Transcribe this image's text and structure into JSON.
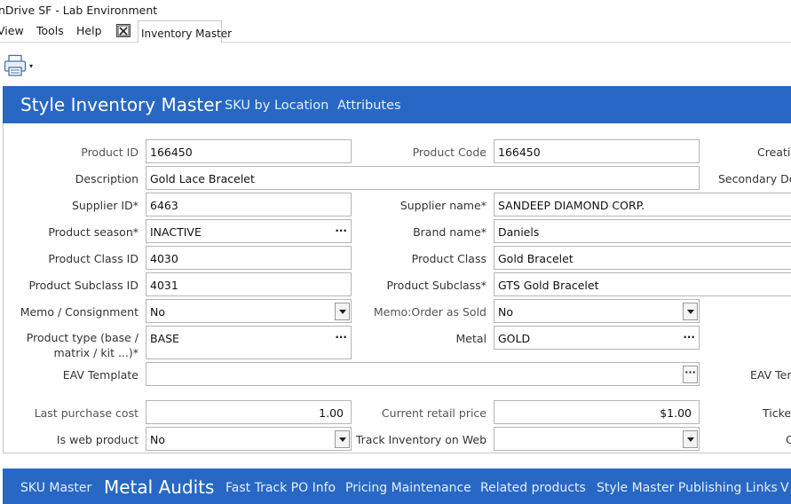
{
  "window": {
    "title": "nDrive SF - Lab Environment"
  },
  "menu": {
    "items": [
      "View",
      "Tools",
      "Help"
    ],
    "doc_tab": "Inventory Master"
  },
  "tabs_top": {
    "active": "Style Inventory Master",
    "others": [
      "SKU by Location",
      "Attributes"
    ]
  },
  "form": {
    "product_id": {
      "label": "Product ID",
      "value": "166450"
    },
    "product_code": {
      "label": "Product Code",
      "value": "166450"
    },
    "creation": {
      "label": "Creatio"
    },
    "description": {
      "label": "Description",
      "value": "Gold Lace Bracelet"
    },
    "secondary_desc": {
      "label": "Secondary De"
    },
    "supplier_id": {
      "label": "Supplier ID*",
      "value": "6463"
    },
    "supplier_name": {
      "label": "Supplier name*",
      "value": "SANDEEP DIAMOND CORP."
    },
    "product_season": {
      "label": "Product season*",
      "value": "INACTIVE"
    },
    "brand_name": {
      "label": "Brand name*",
      "value": "Daniels"
    },
    "product_class_id": {
      "label": "Product Class ID",
      "value": "4030"
    },
    "product_class": {
      "label": "Product Class",
      "value": "Gold Bracelet"
    },
    "product_subclass_id": {
      "label": "Product Subclass ID",
      "value": "4031"
    },
    "product_subclass": {
      "label": "Product Subclass*",
      "value": "GTS Gold Bracelet"
    },
    "memo_consignment": {
      "label": "Memo / Consignment",
      "value": "No"
    },
    "memo_order_as_sold": {
      "label": "Memo:Order as Sold",
      "value": "No"
    },
    "product_type": {
      "label_line1": "Product type (base /",
      "label_line2": "matrix / kit ...)*",
      "value": "BASE"
    },
    "metal": {
      "label": "Metal",
      "value": "GOLD"
    },
    "eav_template": {
      "label": "EAV Template",
      "value": ""
    },
    "eav_tem_right": {
      "label": "EAV Tem"
    },
    "last_purchase_cost": {
      "label": "Last purchase cost",
      "value": "1.00"
    },
    "current_retail_price": {
      "label": "Current retail price",
      "value": "$1.00"
    },
    "ticket": {
      "label": "Ticket"
    },
    "is_web_product": {
      "label": "Is web product",
      "value": "No"
    },
    "track_inventory_web": {
      "label": "Track Inventory on Web",
      "value": ""
    },
    "right_c": {
      "label": "C"
    }
  },
  "tabs_bottom": {
    "items": [
      "SKU Master",
      "Metal Audits",
      "Fast Track PO Info",
      "Pricing Maintenance",
      "Related products",
      "Style Master Publishing Links",
      "V"
    ],
    "active": "Metal Audits"
  },
  "glyphs": {
    "ellipsis": "···",
    "caret_down": "▾"
  },
  "colors": {
    "accent_blue": "#2868c4"
  }
}
